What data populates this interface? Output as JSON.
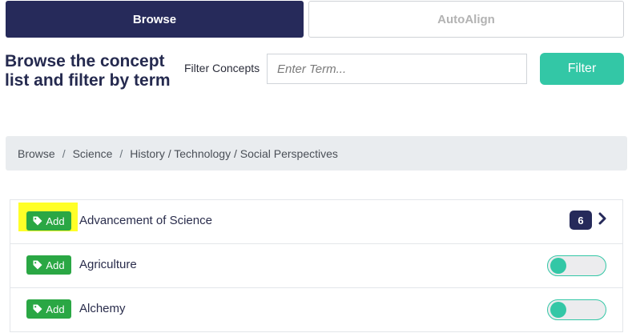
{
  "tabs": {
    "browse_label": "Browse",
    "autoalign_label": "AutoAlign"
  },
  "heading": "Browse the concept list and filter by term",
  "filter": {
    "label": "Filter Concepts",
    "placeholder": "Enter Term...",
    "value": "",
    "button_label": "Filter"
  },
  "breadcrumb": {
    "items": [
      "Browse",
      "Science",
      "History / Technology / Social Perspectives"
    ],
    "separator": "/"
  },
  "concepts": [
    {
      "add_label": "Add",
      "name": "Advancement of Science",
      "count": "6",
      "highlighted": true,
      "icon": "tag-icon"
    },
    {
      "add_label": "Add",
      "name": "Agriculture",
      "toggle_on": false,
      "icon": "tag-icon"
    },
    {
      "add_label": "Add",
      "name": "Alchemy",
      "toggle_on": false,
      "icon": "tag-icon"
    }
  ],
  "colors": {
    "primary": "#262a5a",
    "accent": "#33c7a6",
    "add_green": "#2aa744",
    "highlight": "#ffff28"
  }
}
